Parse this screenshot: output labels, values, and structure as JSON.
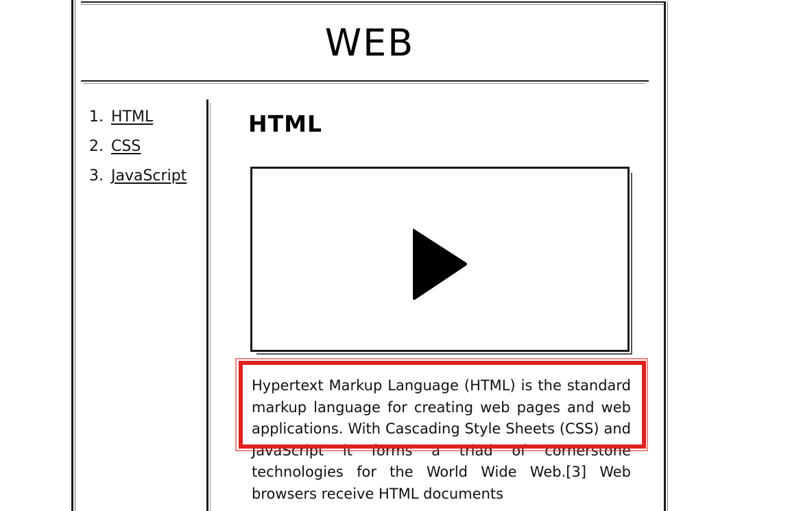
{
  "header": {
    "title": "WEB"
  },
  "nav": {
    "items": [
      {
        "number": "1.",
        "label": "HTML"
      },
      {
        "number": "2.",
        "label": "CSS"
      },
      {
        "number": "3.",
        "label": "JavaScript"
      }
    ]
  },
  "main": {
    "heading": "HTML",
    "video": {
      "icon": "play-icon"
    },
    "body": "Hypertext Markup Language (HTML) is the standard markup language for creating web pages and web applications. With Cascading Style Sheets (CSS) and JavaScript it forms a triad of cornerstone technologies for the World Wide Web.[3] Web browsers receive HTML documents",
    "highlight_color": "#e02020"
  }
}
